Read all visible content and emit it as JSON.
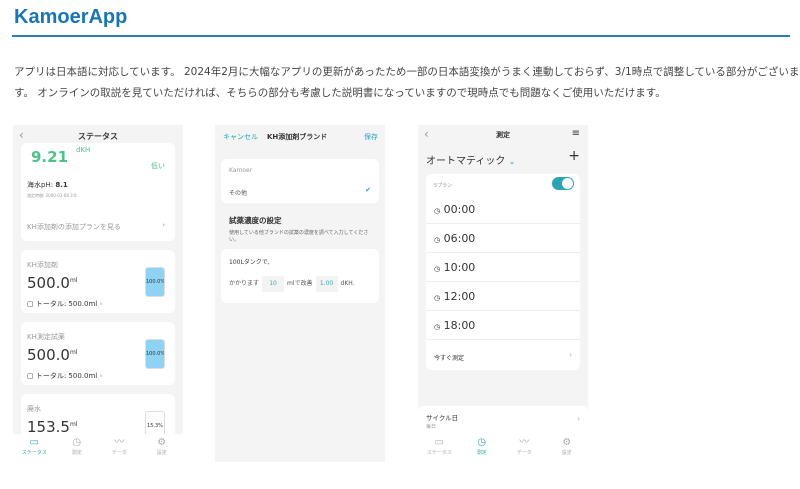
{
  "header": {
    "title": "KamoerApp"
  },
  "intro": {
    "line1": "アプリは日本語に対応しています。 2024年2月に大幅なアプリの更新があったため一部の日本語変換がうまく連動しておらず、3/1時点で調整している部分がございま",
    "line2": "す。 オンラインの取説を見ていただければ、そちらの部分も考慮した説明書になっていますので現時点でも問題なくご使用いただけます。"
  },
  "status_screen": {
    "title": "ステータス",
    "kh_value": "9.21",
    "kh_unit": "dKH",
    "kh_state": "低い",
    "ph_label": "海水pH:",
    "ph_value": "8.1",
    "timestamp": "測定時間: 2000-03-08 3:0",
    "plan_link": "KH添加剤の添加プランを見る",
    "containers": [
      {
        "name": "KH添加剤",
        "value": "500.0",
        "unit": "ml",
        "total": "トータル: 500.0ml",
        "percent_label": "100.0%",
        "percent": 100
      },
      {
        "name": "KH測定試薬",
        "value": "500.0",
        "unit": "ml",
        "total": "トータル: 500.0ml",
        "percent_label": "100.0%",
        "percent": 100
      },
      {
        "name": "廃水",
        "value": "153.5",
        "unit": "ml",
        "percent_label": "15.3%",
        "percent": 15.3
      }
    ]
  },
  "brand_screen": {
    "cancel": "キャンセル",
    "title": "KH添加剤ブランド",
    "save": "保存",
    "options": [
      "Kamoer",
      "その他"
    ],
    "selected": "その他",
    "section_title": "試薬濃度の設定",
    "section_desc": "使用している他ブランドの試薬の濃度を調べて入力してください。",
    "tank_text": "100Lタンクで,",
    "prefix": "かかります",
    "ml_value": "10",
    "mid": "mlで改善",
    "dkh_value": "1.00",
    "suffix": "dKH."
  },
  "measure_screen": {
    "title": "測定",
    "mode": "オートマティック",
    "plan_label": "5プラン",
    "toggle_on": true,
    "times": [
      "00:00",
      "06:00",
      "10:00",
      "12:00",
      "18:00"
    ],
    "measure_now": "今すぐ測定",
    "cycle_label": "サイクル日",
    "cycle_value": "毎日"
  },
  "nav": [
    "ステータス",
    "測定",
    "データ",
    "設定"
  ],
  "colors": {
    "brand": "#1976b4",
    "accent": "#2aa3b5",
    "green": "#4cc38a",
    "gauge": "#8fd3f4"
  }
}
